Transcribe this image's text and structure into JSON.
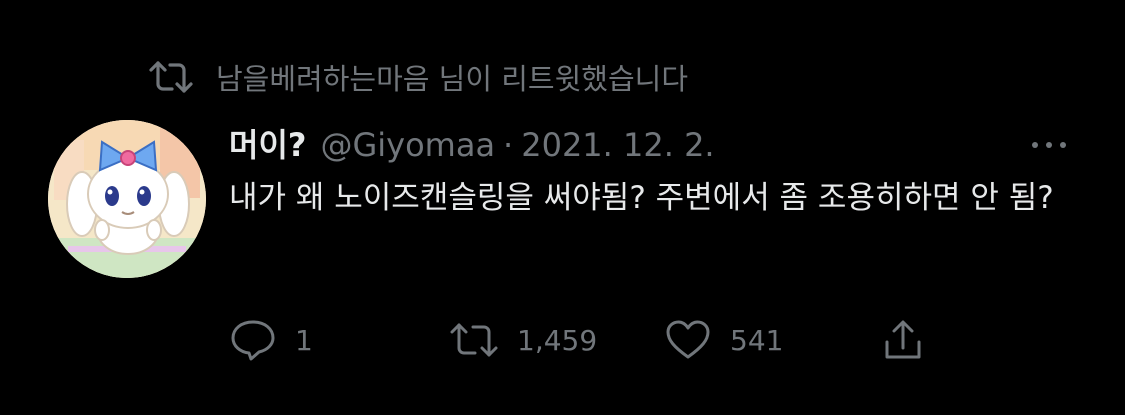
{
  "retweet_context": {
    "text": "남을베려하는마음 님이 리트윗했습니다",
    "icon": "retweet-icon"
  },
  "tweet": {
    "display_name": "머이?",
    "handle": "@Giyomaa",
    "separator": "·",
    "date": "2021. 12. 2.",
    "text": "내가 왜 노이즈캔슬링을 써야됨? 주변에서 좀 조용히하면 안 됨?",
    "avatar_icon": "avatar-character-image"
  },
  "actions": {
    "reply_count": "1",
    "retweet_count": "1,459",
    "like_count": "541"
  },
  "colors": {
    "background": "#000000",
    "text": "#e7e9ea",
    "secondary": "#71767b"
  }
}
